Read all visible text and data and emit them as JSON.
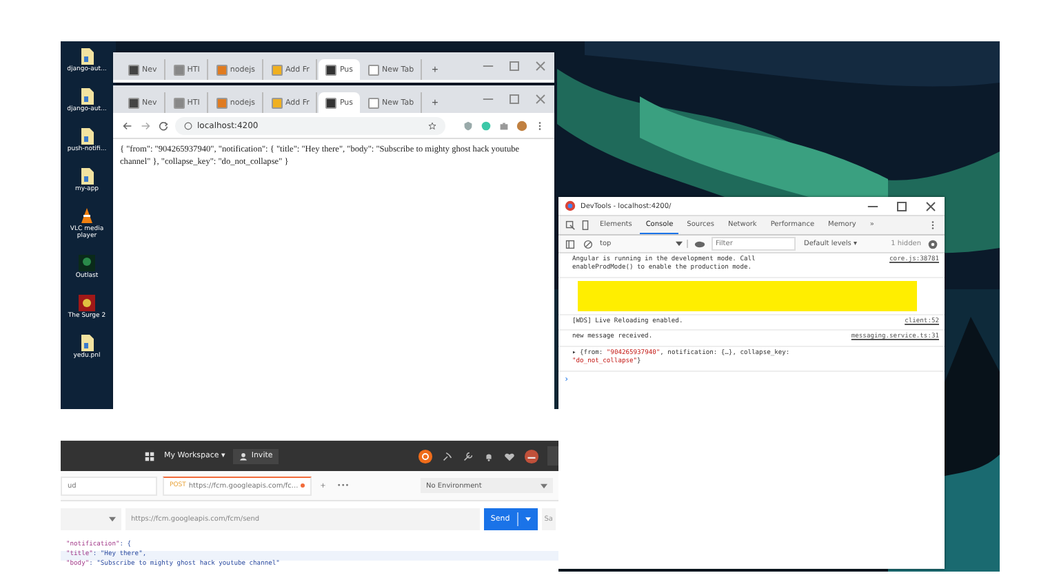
{
  "desktop_icons": [
    {
      "label": "django-aut...",
      "kind": "folder"
    },
    {
      "label": "django-aut...",
      "kind": "folder"
    },
    {
      "label": "push-notifi...",
      "kind": "folder"
    },
    {
      "label": "my-app",
      "kind": "folder"
    },
    {
      "label": "VLC media player",
      "kind": "vlc"
    },
    {
      "label": "Outlast",
      "kind": "game"
    },
    {
      "label": "The Surge 2",
      "kind": "game2"
    },
    {
      "label": "yedu.pnl",
      "kind": "folder"
    }
  ],
  "browser_windows": [
    {
      "tabs": [
        {
          "label": "Nev",
          "selected": false,
          "color": "#444444"
        },
        {
          "label": "HTI",
          "selected": false,
          "color": "#888888"
        },
        {
          "label": "nodejs",
          "selected": false,
          "color": "#e07b20"
        },
        {
          "label": "Add Fr",
          "selected": false,
          "color": "#f0b020"
        },
        {
          "label": "Pus",
          "selected": true,
          "color": "#333333"
        },
        {
          "label": "New Tab",
          "selected": false,
          "color": "#ffffff"
        }
      ],
      "new_tab": "+"
    },
    {
      "tabs": [
        {
          "label": "Nev",
          "selected": false,
          "color": "#444444"
        },
        {
          "label": "HTI",
          "selected": false,
          "color": "#888888"
        },
        {
          "label": "nodejs",
          "selected": false,
          "color": "#e07b20"
        },
        {
          "label": "Add Fr",
          "selected": false,
          "color": "#f0b020"
        },
        {
          "label": "Pus",
          "selected": true,
          "color": "#333333"
        },
        {
          "label": "New Tab",
          "selected": false,
          "color": "#ffffff"
        }
      ],
      "new_tab": "+",
      "address": "localhost:4200",
      "page_text": "{ \"from\": \"904265937940\", \"notification\": { \"title\": \"Hey there\", \"body\": \"Subscribe to mighty ghost hack youtube channel\" }, \"collapse_key\": \"do_not_collapse\" }"
    }
  ],
  "devtools": {
    "title": "DevTools - localhost:4200/",
    "tabs": [
      {
        "label": "Elements",
        "selected": false
      },
      {
        "label": "Console",
        "selected": true
      },
      {
        "label": "Sources",
        "selected": false
      },
      {
        "label": "Network",
        "selected": false
      },
      {
        "label": "Performance",
        "selected": false
      },
      {
        "label": "Memory",
        "selected": false
      }
    ],
    "more": "»",
    "context": "top",
    "filter": {
      "placeholder": "Filter"
    },
    "levels": "Default levels ▾",
    "hidden": "1 hidden",
    "messages": [
      {
        "kind": "log",
        "text": "Angular is running in the development mode. Call enableProdMode() to enable the production mode.",
        "source": "core.js:38781"
      },
      {
        "kind": "redacted"
      },
      {
        "kind": "log",
        "text": "[WDS] Live Reloading enabled.",
        "source": "client:52"
      },
      {
        "kind": "log",
        "text": "new message received.",
        "source": "messaging.service.ts:31"
      },
      {
        "kind": "object",
        "parts": [
          {
            "text": "▸ {from: ",
            "kind": "plain"
          },
          {
            "text": "\"904265937940\"",
            "kind": "string"
          },
          {
            "text": ", notification: {…}, collapse_key: ",
            "kind": "plain"
          },
          {
            "text": "\"do_not_collapse\"",
            "kind": "string"
          },
          {
            "text": "}",
            "kind": "plain"
          }
        ]
      }
    ],
    "prompt": "›"
  },
  "postman": {
    "workspace": "My Workspace ▾",
    "invite": "Invite",
    "tabs": [
      {
        "label": "ud",
        "selected": false,
        "unsaved": false
      },
      {
        "method": "POST",
        "label": "https://fcm.googleapis.com/fc...",
        "selected": true,
        "unsaved": true
      }
    ],
    "new_tab": "+",
    "more": "•••",
    "environment": "No Environment",
    "url": "https://fcm.googleapis.com/fcm/send",
    "send": "Send",
    "save": "Sa",
    "body_lines": [
      {
        "key": "\"notification\"",
        "rest": ": {"
      },
      {
        "key": "\"title\"",
        "rest": ": \"Hey there\","
      },
      {
        "key": "\"body\"",
        "rest": ": \"Subscribe to mighty ghost hack youtube channel\""
      }
    ]
  }
}
